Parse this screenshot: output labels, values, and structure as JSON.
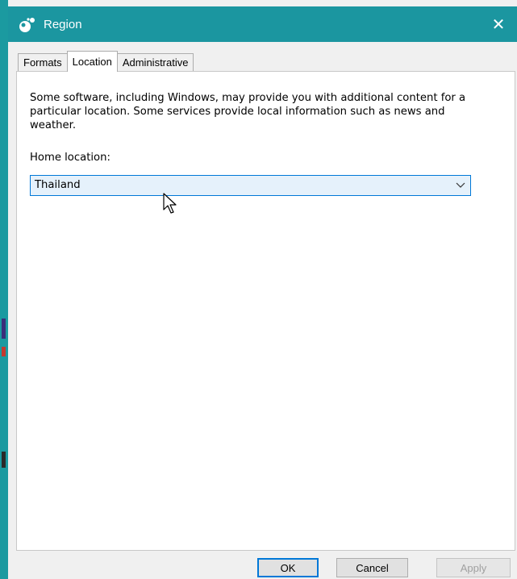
{
  "window": {
    "title": "Region",
    "close_glyph": "✕",
    "accent_color": "#1b96a0"
  },
  "tabs": [
    {
      "label": "Formats",
      "active": false
    },
    {
      "label": "Location",
      "active": true
    },
    {
      "label": "Administrative",
      "active": false
    }
  ],
  "location": {
    "description": "Some software, including Windows, may provide you with additional content for a particular location. Some services provide local information such as news and weather.",
    "home_label": "Home location:",
    "home_value": "Thailand"
  },
  "buttons": {
    "ok": "OK",
    "cancel": "Cancel",
    "apply": "Apply"
  },
  "icons": {
    "app": "region-globe-icon",
    "close": "close-icon",
    "dropdown": "chevron-down-icon",
    "pointer": "mouse-pointer-icon"
  }
}
